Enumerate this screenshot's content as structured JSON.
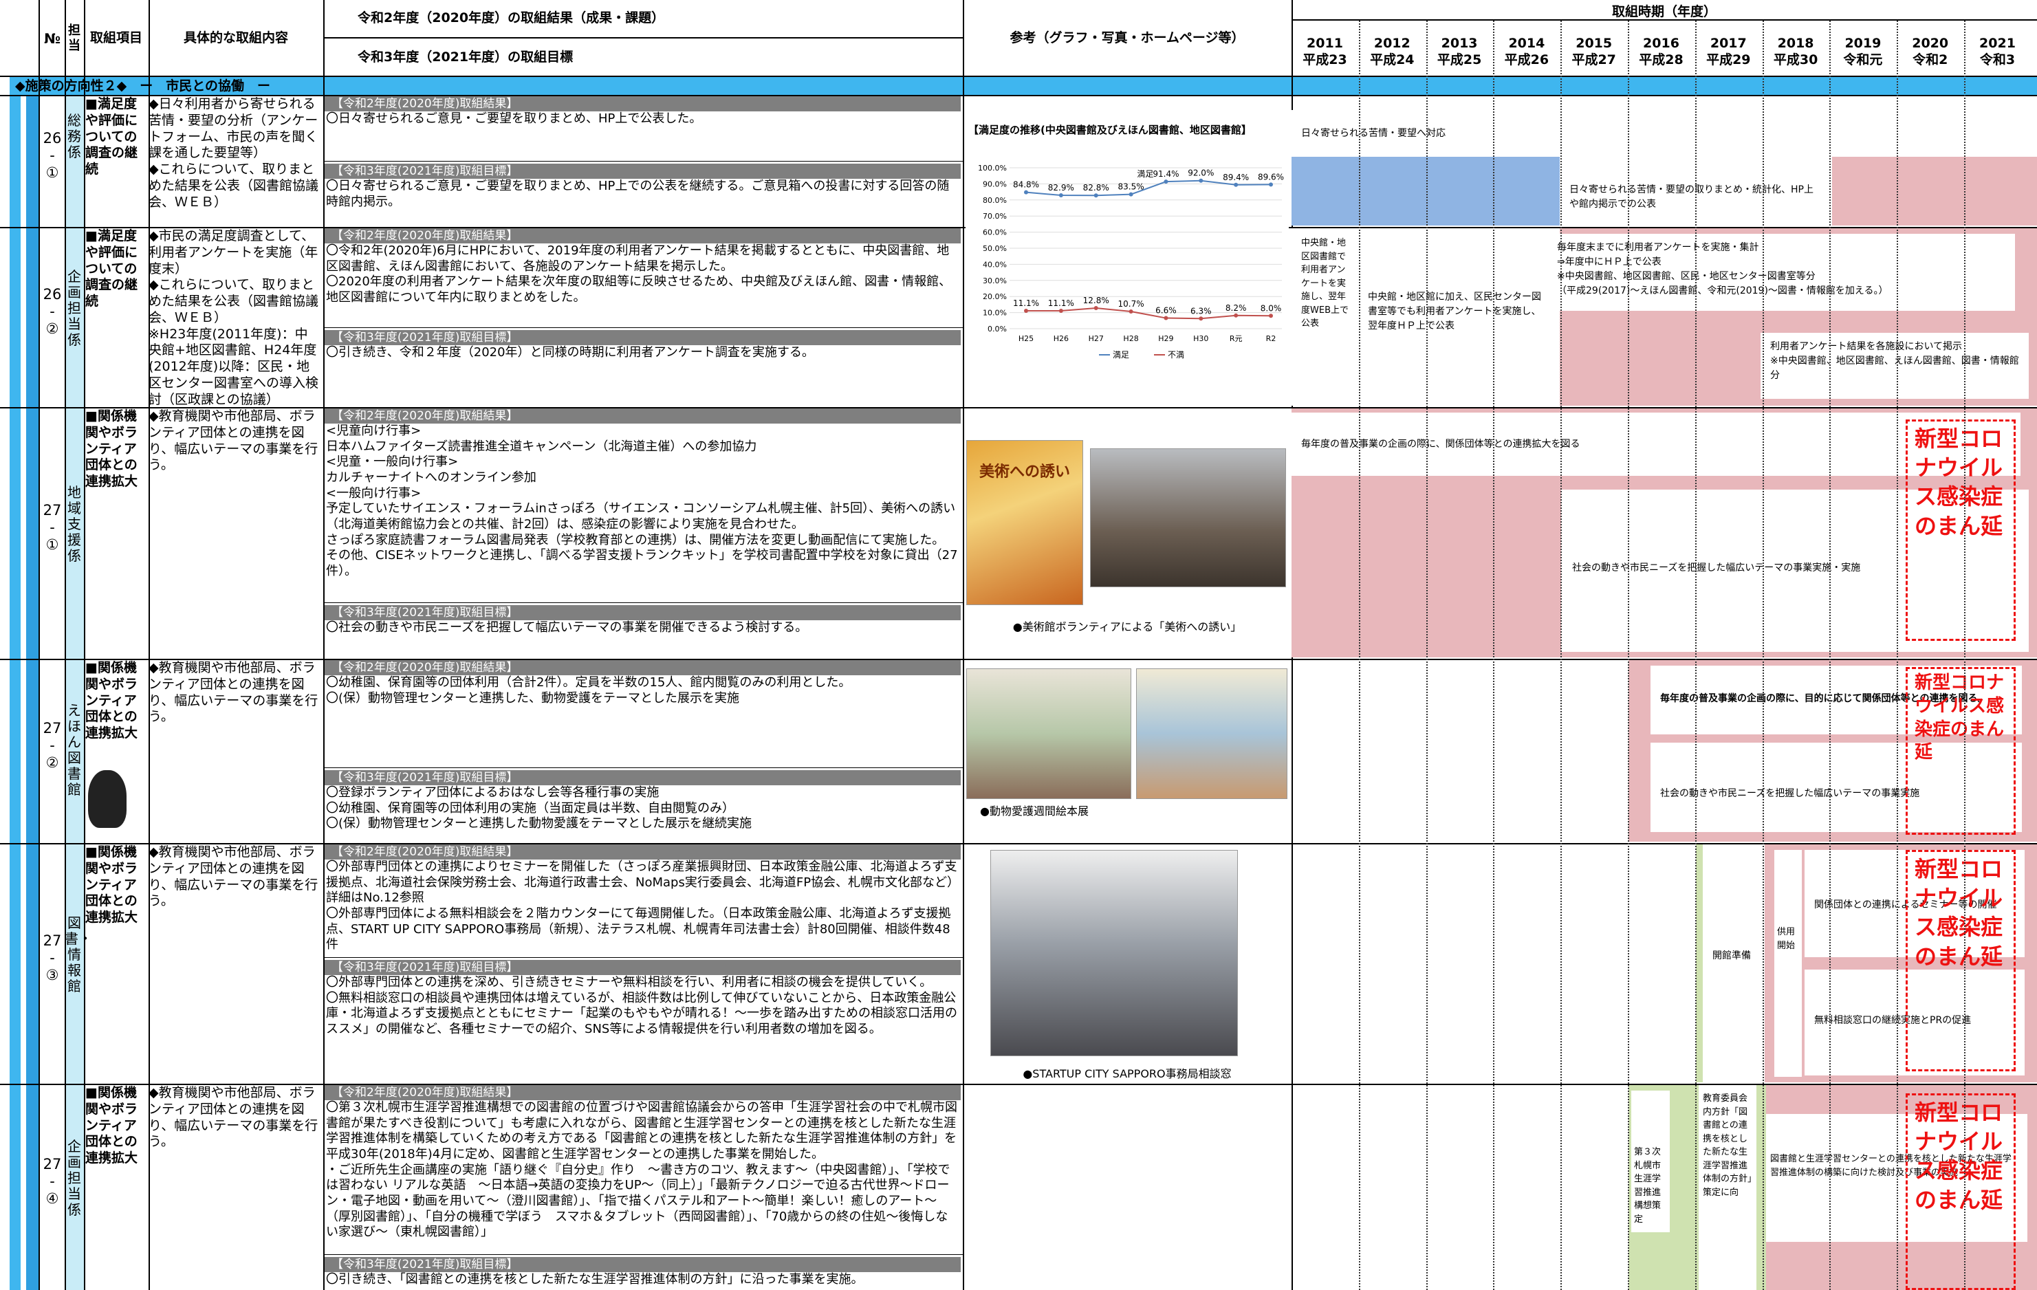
{
  "header": {
    "no": "№",
    "tanto": "担当",
    "item": "取組項目",
    "content": "具体的な取組内容",
    "result_h": "令和2年度（2020年度）の取組結果（成果・課題）",
    "target_h": "令和3年度（2021年度）の取組目標",
    "ref_h": "参考（グラフ・写真・ホームページ等）",
    "period_h": "取組時期（年度）"
  },
  "years": [
    {
      "y": "2011",
      "w": "平成23"
    },
    {
      "y": "2012",
      "w": "平成24"
    },
    {
      "y": "2013",
      "w": "平成25"
    },
    {
      "y": "2014",
      "w": "平成26"
    },
    {
      "y": "2015",
      "w": "平成27"
    },
    {
      "y": "2016",
      "w": "平成28"
    },
    {
      "y": "2017",
      "w": "平成29"
    },
    {
      "y": "2018",
      "w": "平成30"
    },
    {
      "y": "2019",
      "w": "令和元"
    },
    {
      "y": "2020",
      "w": "令和2"
    },
    {
      "y": "2021",
      "w": "令和3"
    }
  ],
  "section": "◆施策の方向性２◆　ー　市民との協働　ー",
  "label_result": "【令和2年度(2020年度)取組結果】",
  "label_target": "【令和3年度(2021年度)取組目標】",
  "covid": "新型コロナウイルス感染症のまん延",
  "rows": [
    {
      "no": "26\n-\n①",
      "tanto": "総務係",
      "item": "■満足度や評価についての調査の継続",
      "content": "◆日々利用者から寄せられる苦情・要望の分析（アンケートフォーム、市民の声を聞く課を通した要望等）\n◆これらについて、取りまとめた結果を公表（図書館協議会、ＷＥＢ）",
      "result": "〇日々寄せられるご意見・ご要望を取りまとめ、HP上で公表した。",
      "target": "〇日々寄せられるご意見・ご要望を取りまとめ、HP上での公表を継続する。ご意見箱への投書に対する回答の随時館内掲示。",
      "bar1": "日々寄せられる苦情・要望へ対応",
      "bar2": "日々寄せられる苦情・要望の取りまとめ・統計化、HP上や館内掲示での公表"
    },
    {
      "no": "26\n-\n②",
      "tanto": "企画担当係",
      "item": "■満足度や評価についての調査の継続",
      "content": "◆市民の満足度調査として、利用者アンケートを実施（年度末）\n◆これらについて、取りまとめた結果を公表（図書館協議会、ＷＥＢ）\n※H23年度(2011年度)：中央館+地区図書館、H24年度(2012年度)以降：区民・地区センター図書室への導入検討（区政課との協議）",
      "result": "〇令和2年(2020年)6月にHPにおいて、2019年度の利用者アンケート結果を掲載するとともに、中央図書館、地区図書館、えほん図書館において、各施設のアンケート結果を掲示した。\n〇2020年度の利用者アンケート結果を次年度の取組等に反映させるため、中央館及びえほん館、図書・情報館、地区図書館について年内に取りまとめをした。",
      "target": "〇引き続き、令和２年度（2020年）と同様の時期に利用者アンケート調査を実施する。",
      "bar1": "中央館・地区図書館で利用者アンケートを実施し、翌年度WEB上で公表",
      "bar2": "中央館・地区館に加え、区民センター図書室等でも利用者アンケートを実施し、翌年度ＨＰ上で公表",
      "bar3": "毎年度末までに利用者アンケートを実施・集計\n⇒年度中にＨＰ上で公表\n※中央図書館、地区図書館、区民・地区センター図書室等分\n（平成29(2017)～えほん図書館、令和元(2019)～図書・情報館を加える。）",
      "bar4": "利用者アンケート結果を各施設において掲示\n※中央図書館、地区図書館、えほん図書館、図書・情報館分"
    },
    {
      "no": "27\n-\n①",
      "tanto": "地域支援係",
      "item": "■関係機関やボランティア団体との連携拡大",
      "content": "◆教育機関や市他部局、ボランティア団体との連携を図り、幅広いテーマの事業を行う。",
      "result": "<児童向け行事>\n日本ハムファイターズ読書推進全道キャンペーン（北海道主催）への参加協力\n<児童・一般向け行事>\nカルチャーナイトへのオンライン参加\n<一般向け行事>\n予定していたサイエンス・フォーラムinさっぽろ（サイエンス・コンソーシアム札幌主催、計5回）、美術への誘い（北海道美術館協力会との共催、計2回）は、感染症の影響により実施を見合わせた。\nさっぽろ家庭読書フォーラム図書局発表（学校教育部との連携）は、開催方法を変更し動画配信にて実施した。\nその他、CISEネットワークと連携し、「調べる学習支援トランクキット」を学校司書配置中学校を対象に貸出（27件）。",
      "target": "〇社会の動きや市民ニーズを把握して幅広いテーマの事業を開催できるよう検討する。",
      "caption": "●美術館ボランティアによる「美術への誘い」",
      "poster": "美術への誘い",
      "bar1": "毎年度の普及事業の企画の際に、関係団体等との連携拡大を図る",
      "bar2": "社会の動きや市民ニーズを把握した幅広いテーマの事業実施・実施"
    },
    {
      "no": "27\n-\n②",
      "tanto": "えほん図書館",
      "item": "■関係機関やボランティア団体との連携拡大",
      "content": "◆教育機関や市他部局、ボランティア団体との連携を図り、幅広いテーマの事業を行う。",
      "result": "〇幼稚園、保育園等の団体利用（合計2件）。定員を半数の15人、館内閲覧のみの利用とした。\n〇(保）動物管理センターと連携した、動物愛護をテーマとした展示を実施",
      "target": "〇登録ボランティア団体によるおはなし会等各種行事の実施\n〇幼稚園、保育園等の団体利用の実施（当面定員は半数、自由閲覧のみ）\n〇(保）動物管理センターと連携した動物愛護をテーマとした展示を継続実施",
      "caption": "●動物愛護週間絵本展",
      "bar1": "毎年度の普及事業の企画の際に、目的に応じて関係団体等との連携を図る。",
      "bar2": "社会の動きや市民ニーズを把握した幅広いテーマの事業実施"
    },
    {
      "no": "27\n-\n③",
      "tanto": "図書・情報館",
      "item": "■関係機関やボランティア団体との連携拡大",
      "content": "◆教育機関や市他部局、ボランティア団体との連携を図り、幅広いテーマの事業を行う。",
      "result": "〇外部専門団体との連携によりセミナーを開催した（さっぽろ産業振興財団、日本政策金融公庫、北海道よろず支援拠点、北海道社会保険労務士会、北海道行政書士会、NoMaps実行委員会、北海道FP協会、札幌市文化部など）詳細はNo.12参照\n〇外部専門団体による無料相談会を２階カウンターにて毎週開催した。（日本政策金融公庫、北海道よろず支援拠点、START UP CITY SAPPORO事務局（新規）、法テラス札幌、札幌青年司法書士会）計80回開催、相談件数48件",
      "target": "〇外部専門団体との連携を深め、引き続きセミナーや無料相談を行い、利用者に相談の機会を提供していく。\n〇無料相談窓口の相談員や連携団体は増えているが、相談件数は比例して伸びていないことから、日本政策金融公庫・北海道よろず支援拠点とともにセミナー「起業のもやもやが晴れる！～一歩を踏み出すための相談窓口活用のススメ」の開催など、各種セミナーでの紹介、SNS等による情報提供を行い利用者数の増加を図る。",
      "caption": "●STARTUP CITY SAPPORO事務局相談窓",
      "bar1": "開館準備",
      "bar2": "供用開始",
      "bar3": "関係団体との連携によるセミナー等の開催",
      "bar4": "無料相談窓口の継続実施とPRの促進"
    },
    {
      "no": "27\n-\n④",
      "tanto": "企画担当係",
      "item": "■関係機関やボランティア団体との連携拡大",
      "content": "◆教育機関や市他部局、ボランティア団体との連携を図り、幅広いテーマの事業を行う。",
      "result": "〇第３次札幌市生涯学習推進構想での図書館の位置づけや図書館協議会からの答申「生涯学習社会の中で札幌市図書館が果たすべき役割について」も考慮に入れながら、図書館と生涯学習センターとの連携を核とした新たな生涯学習推進体制を構築していくための考え方である「図書館との連携を核とした新たな生涯学習推進体制の方針」を平成30年(2018年)4月に定め、図書館と生涯学習センターとの連携した事業を開始した。\n・ご近所先生企画講座の実施「語り継ぐ『自分史』作り　～書き方のコツ、教えます～（中央図書館）」、「学校では習わない リアルな英語　～日本語→英語の変換力をUP～（同上）」「最新テクノロジーで迫る古代世界～ドローン・電子地図・動画を用いて～（澄川図書館）」、「指で描くパステル和アート～簡単！楽しい！癒しのアート～（厚別図書館）」、「自分の機種で学ぼう　スマホ＆タブレット（西岡図書館）」、「70歳からの終の住処～後悔しない家選び～（東札幌図書館）」",
      "target": "〇引き続き、「図書館との連携を核とした新たな生涯学習推進体制の方針」に沿った事業を実施。",
      "bar1": "第３次札幌市生涯学習推進構想策定",
      "bar2": "教育委員会内方針「図書館との連携を核とした新たな生涯学習推進体制の方針」策定に向",
      "bar3": "図書館と生涯学習センターとの連携を核とした新たな生涯学習推進体制の構築に向けた検討及び事業の実施"
    }
  ],
  "chart_data": {
    "type": "line",
    "title": "【満足度の推移(中央図書館及びえほん図書館、地区図書館】",
    "categories": [
      "H25",
      "H26",
      "H27",
      "H28",
      "H29",
      "H30",
      "R元",
      "R2"
    ],
    "series": [
      {
        "name": "満足",
        "values": [
          84.8,
          82.9,
          82.8,
          83.5,
          91.4,
          92.0,
          89.4,
          89.6
        ],
        "color": "#4f81bd"
      },
      {
        "name": "不満",
        "values": [
          11.1,
          11.1,
          12.8,
          10.7,
          6.6,
          6.3,
          8.2,
          8.0
        ],
        "color": "#c0504d"
      }
    ],
    "yticks": [
      "100.0%",
      "90.0%",
      "80.0%",
      "70.0%",
      "60.0%",
      "50.0%",
      "40.0%",
      "30.0%",
      "20.0%",
      "10.0%",
      "0.0%"
    ],
    "ylim": [
      0,
      100
    ],
    "labels_top": [
      "84.8%",
      "82.9%",
      "82.8%",
      "83.5%",
      "91.4%",
      "92.0%",
      "89.4%",
      "89.6%"
    ],
    "labels_bot": [
      "11.1%",
      "11.1%",
      "12.8%",
      "10.7%",
      "6.6%",
      "6.3%",
      "8.2%",
      "8.0%"
    ],
    "annot": "満足"
  }
}
